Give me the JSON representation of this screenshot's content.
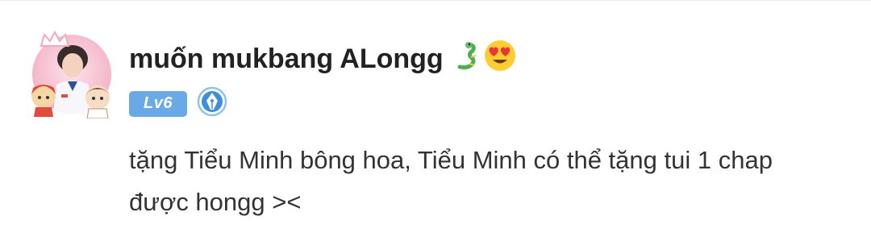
{
  "comment": {
    "username": "muốn mukbang ALongg",
    "username_emojis": [
      "dragon-icon",
      "heart-eyes-emoji-icon"
    ],
    "level_badge": "Lv6",
    "author_badge_icon": "pen-nib-icon",
    "text": "tặng Tiểu Minh bông hoa, Tiểu Minh có thể tặng tui 1 chap được hongg ><"
  },
  "colors": {
    "level_badge_bg": "#68a9e6",
    "author_badge_bg": "#3f8fd8",
    "username_text": "#222222",
    "comment_text": "#333333",
    "avatar_frame": "#f4a7bd"
  }
}
